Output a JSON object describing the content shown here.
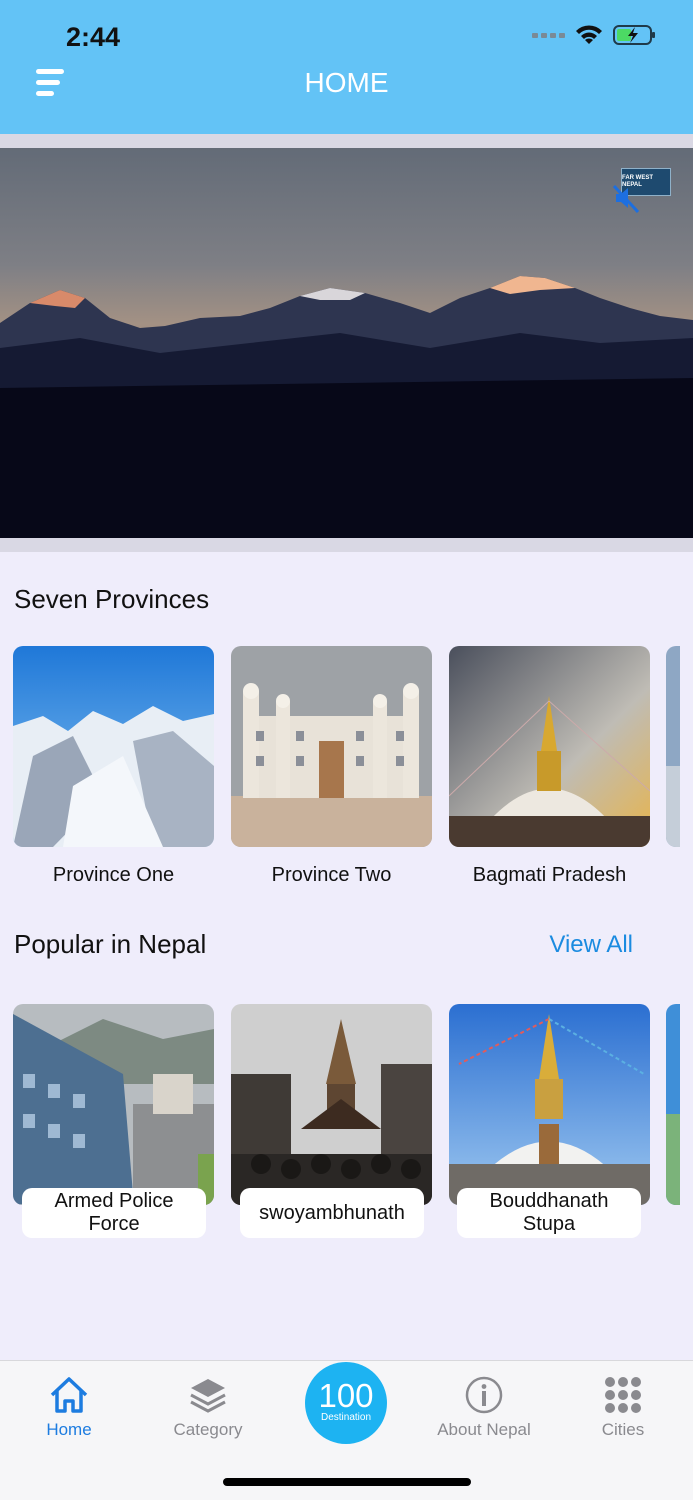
{
  "status": {
    "time": "2:44"
  },
  "header": {
    "title": "HOME"
  },
  "hero": {
    "logo_text": "FAR WEST NEPAL"
  },
  "provinces": {
    "title": "Seven Provinces",
    "items": [
      {
        "label": "Province One"
      },
      {
        "label": "Province Two"
      },
      {
        "label": "Bagmati Pradesh"
      }
    ]
  },
  "popular": {
    "title": "Popular in Nepal",
    "view_all": "View All",
    "items": [
      {
        "label": "Armed Police Force"
      },
      {
        "label": "swoyambhunath"
      },
      {
        "label": "Bouddhanath Stupa"
      }
    ]
  },
  "tabbar": {
    "home": "Home",
    "category": "Category",
    "center_number": "100",
    "center_sub": "Destination",
    "about": "About Nepal",
    "cities": "Cities"
  },
  "colors": {
    "header": "#63c3f6",
    "accent": "#1d7ce0",
    "center_button": "#1db3f2",
    "background": "#efedfb"
  },
  "icons": [
    "menu-icon",
    "wifi-icon",
    "battery-charging-icon",
    "mute-icon",
    "home-icon",
    "layers-icon",
    "info-icon",
    "grid-icon"
  ]
}
